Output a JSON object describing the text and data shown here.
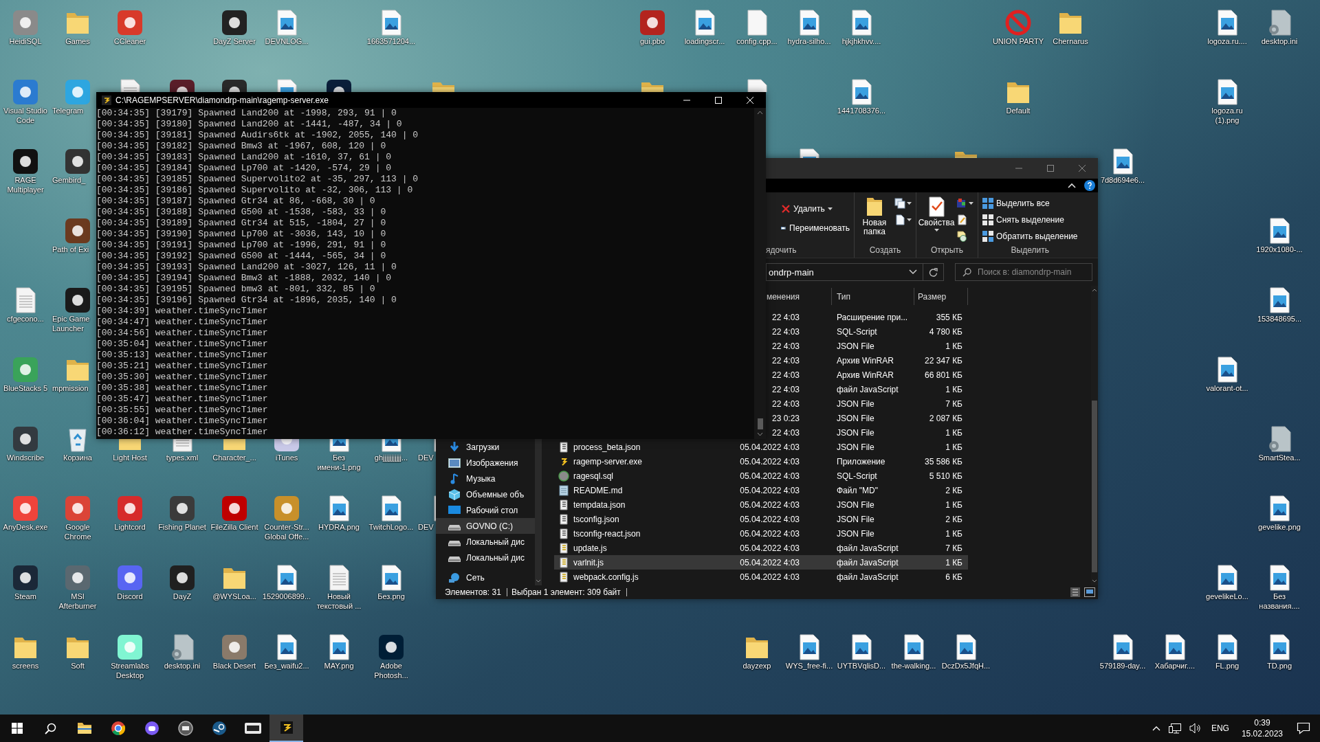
{
  "desktop": {
    "icons": [
      {
        "label": "HeidiSQL",
        "kind": "app",
        "color": "#8a8a8a"
      },
      {
        "label": "Games",
        "kind": "folder"
      },
      {
        "label": "CCleaner",
        "kind": "app",
        "color": "#d83a2a"
      },
      {
        "label": "DayZ Server",
        "kind": "app",
        "color": "#222222"
      },
      {
        "label": "DEVNLOG...",
        "kind": "image"
      },
      {
        "label": "1663571204...",
        "kind": "image"
      },
      {
        "label": "gui.pbo",
        "kind": "app",
        "color": "#b3241e"
      },
      {
        "label": "loadingscr...",
        "kind": "image"
      },
      {
        "label": "config.cpp...",
        "kind": "blank"
      },
      {
        "label": "hydra-silho...",
        "kind": "image"
      },
      {
        "label": "hjkjhkhvv....",
        "kind": "image"
      },
      {
        "label": "UNION PARTY",
        "kind": "ban"
      },
      {
        "label": "Chernarus",
        "kind": "folder"
      },
      {
        "label": "logoza.ru....",
        "kind": "image"
      },
      {
        "label": "desktop.ini",
        "kind": "ini"
      },
      {
        "label": "Visual Studio Code",
        "kind": "app",
        "color": "#2b7bd0"
      },
      {
        "label": "Telegram",
        "kind": "app",
        "color": "#2ea6e0",
        "cut": true
      },
      {
        "kind": "text"
      },
      {
        "kind": "app",
        "color": "#5a1e2a"
      },
      {
        "kind": "app",
        "color": "#2a2a2a"
      },
      {
        "kind": "image"
      },
      {
        "kind": "app",
        "color": "#0b1f3a"
      },
      {
        "kind": "folder"
      },
      {
        "kind": "folder"
      },
      {
        "kind": "blank"
      },
      {
        "label": "1441708376...",
        "kind": "image"
      },
      {
        "label": "Default",
        "kind": "folder"
      },
      {
        "label": "logoza.ru (1).png",
        "kind": "image"
      },
      {
        "label": "RAGE Multiplayer",
        "kind": "app",
        "color": "#111111"
      },
      {
        "label": "Gembird_",
        "kind": "app",
        "color": "#333333",
        "cut": true
      },
      {
        "kind": "image"
      },
      {
        "kind": "folder"
      },
      {
        "label": "7d8d694e6...",
        "kind": "image"
      },
      {
        "label": "Path of Exi",
        "kind": "app",
        "color": "#6b3a1f",
        "cut": true
      },
      {
        "label": "1920x1080-...",
        "kind": "image"
      },
      {
        "label": "cfgecono...",
        "kind": "text"
      },
      {
        "label": "Epic Game Launcher",
        "kind": "app",
        "color": "#1a1a1a",
        "cut": true
      },
      {
        "label": "153848695...",
        "kind": "image"
      },
      {
        "label": "BlueStacks 5",
        "kind": "app",
        "color": "#3aa35a"
      },
      {
        "label": "mpmission",
        "kind": "folder",
        "cut": true
      },
      {
        "label": "valorant-ot...",
        "kind": "image"
      },
      {
        "label": "Windscribe",
        "kind": "app",
        "color": "#333a40"
      },
      {
        "label": "Корзина",
        "kind": "recycle"
      },
      {
        "label": "Light Host",
        "kind": "folder"
      },
      {
        "label": "types.xml",
        "kind": "text"
      },
      {
        "label": "Character_...",
        "kind": "folder"
      },
      {
        "label": "iTunes",
        "kind": "app",
        "color": "#c9c9e8"
      },
      {
        "label": "Без имени-1.png",
        "kind": "image"
      },
      {
        "label": "ghjjjjjjjjjjj...",
        "kind": "image"
      },
      {
        "label": "DEV",
        "kind": "image",
        "cut": true
      },
      {
        "label": "SmartStea...",
        "kind": "ini"
      },
      {
        "label": "AnyDesk.exe",
        "kind": "app",
        "color": "#ef443b"
      },
      {
        "label": "Google Chrome",
        "kind": "app",
        "color": "#db4437"
      },
      {
        "label": "Lightcord",
        "kind": "app",
        "color": "#d62b2b"
      },
      {
        "label": "Fishing Planet",
        "kind": "app",
        "color": "#3b3b3b"
      },
      {
        "label": "FileZilla Client",
        "kind": "app",
        "color": "#bf0000"
      },
      {
        "label": "Counter-Str... Global Offe...",
        "kind": "app",
        "color": "#c8902a"
      },
      {
        "label": "HYDRA.png",
        "kind": "image"
      },
      {
        "label": "TwitchLogo...",
        "kind": "image"
      },
      {
        "label": "DEV",
        "kind": "image",
        "cut": true
      },
      {
        "label": "gevelike.png",
        "kind": "image"
      },
      {
        "label": "Steam",
        "kind": "app",
        "color": "#1b2838"
      },
      {
        "label": "MSI Afterburner",
        "kind": "app",
        "color": "#5a6870"
      },
      {
        "label": "Discord",
        "kind": "app",
        "color": "#5865f2"
      },
      {
        "label": "DayZ",
        "kind": "app",
        "color": "#202020"
      },
      {
        "label": "@WYSLoa...",
        "kind": "folder"
      },
      {
        "label": "1529006899...",
        "kind": "image"
      },
      {
        "label": "Новый текстовый ...",
        "kind": "text"
      },
      {
        "label": "Без.png",
        "kind": "image"
      },
      {
        "label": "gevelikeLo...",
        "kind": "image"
      },
      {
        "label": "Без названия....",
        "kind": "image"
      },
      {
        "label": "screens",
        "kind": "folder"
      },
      {
        "label": "Soft",
        "kind": "folder"
      },
      {
        "label": "Streamlabs Desktop",
        "kind": "app",
        "color": "#80f5d2"
      },
      {
        "label": "desktop.ini",
        "kind": "ini"
      },
      {
        "label": "Black Desert",
        "kind": "app",
        "color": "#8a7a6a"
      },
      {
        "label": "Без_waifu2...",
        "kind": "image"
      },
      {
        "label": "MAY.png",
        "kind": "image"
      },
      {
        "label": "Adobe Photosh...",
        "kind": "app",
        "color": "#001e36"
      },
      {
        "label": "dayzexp",
        "kind": "folder"
      },
      {
        "label": "WYS_free-fi...",
        "kind": "image"
      },
      {
        "label": "UYTBVqlisD...",
        "kind": "image"
      },
      {
        "label": "the-walking...",
        "kind": "image"
      },
      {
        "label": "DczDx5JfqH...",
        "kind": "image"
      },
      {
        "label": "579189-day...",
        "kind": "image"
      },
      {
        "label": "Хабарчиг....",
        "kind": "image"
      },
      {
        "label": "FL.png",
        "kind": "image"
      },
      {
        "label": "TD.png",
        "kind": "image"
      }
    ]
  },
  "console": {
    "title": "C:\\RAGEMPSERVER\\diamondrp-main\\ragemp-server.exe",
    "lines": [
      "[00:34:35] [39179] Spawned Land200 at -1998, 293, 91 | 0",
      "[00:34:35] [39180] Spawned Land200 at -1441, -487, 34 | 0",
      "[00:34:35] [39181] Spawned Audirs6tk at -1902, 2055, 140 | 0",
      "[00:34:35] [39182] Spawned Bmw3 at -1967, 608, 120 | 0",
      "[00:34:35] [39183] Spawned Land200 at -1610, 37, 61 | 0",
      "[00:34:35] [39184] Spawned Lp700 at -1420, -574, 29 | 0",
      "[00:34:35] [39185] Spawned Supervolito2 at -35, 297, 113 | 0",
      "[00:34:35] [39186] Spawned Supervolito at -32, 306, 113 | 0",
      "[00:34:35] [39187] Spawned Gtr34 at 86, -668, 30 | 0",
      "[00:34:35] [39188] Spawned G500 at -1538, -583, 33 | 0",
      "[00:34:35] [39189] Spawned Gtr34 at 515, -1804, 27 | 0",
      "[00:34:35] [39190] Spawned Lp700 at -3036, 143, 10 | 0",
      "[00:34:35] [39191] Spawned Lp700 at -1996, 291, 91 | 0",
      "[00:34:35] [39192] Spawned G500 at -1444, -565, 34 | 0",
      "[00:34:35] [39193] Spawned Land200 at -3027, 126, 11 | 0",
      "[00:34:35] [39194] Spawned Bmw3 at -1888, 2032, 140 | 0",
      "[00:34:35] [39195] Spawned bmw3 at -801, 332, 85 | 0",
      "[00:34:35] [39196] Spawned Gtr34 at -1896, 2035, 140 | 0",
      "[00:34:39] weather.timeSyncTimer",
      "[00:34:47] weather.timeSyncTimer",
      "[00:34:56] weather.timeSyncTimer",
      "[00:35:04] weather.timeSyncTimer",
      "[00:35:13] weather.timeSyncTimer",
      "[00:35:21] weather.timeSyncTimer",
      "[00:35:30] weather.timeSyncTimer",
      "[00:35:38] weather.timeSyncTimer",
      "[00:35:47] weather.timeSyncTimer",
      "[00:35:55] weather.timeSyncTimer",
      "[00:36:04] weather.timeSyncTimer",
      "[00:36:12] weather.timeSyncTimer"
    ]
  },
  "explorer": {
    "ribbon": {
      "delete": "Удалить",
      "rename": "Переименовать",
      "new_folder": "Новая папка",
      "properties": "Свойства",
      "select_all": "Выделить все",
      "select_none": "Снять выделение",
      "invert_selection": "Обратить выделение",
      "groups": [
        "ядочить",
        "Создать",
        "Открыть",
        "Выделить"
      ]
    },
    "address": "ondrp-main",
    "search": {
      "placeholder": "Поиск в: diamondrp-main"
    },
    "columns": [
      "менения",
      "Тип",
      "Размер"
    ],
    "nav": [
      {
        "label": "Загрузки",
        "kind": "downloads",
        "selected": false
      },
      {
        "label": "Изображения",
        "kind": "pictures",
        "selected": false
      },
      {
        "label": "Музыка",
        "kind": "music",
        "selected": false
      },
      {
        "label": "Объемные объ",
        "kind": "objects",
        "selected": false
      },
      {
        "label": "Рабочий стол",
        "kind": "desktop",
        "selected": false
      },
      {
        "label": "GOVNO (C:)",
        "kind": "drive",
        "selected": true
      },
      {
        "label": "Локальный дис",
        "kind": "drive",
        "selected": false
      },
      {
        "label": "Локальный дис",
        "kind": "drive",
        "selected": false
      },
      {
        "label": "Сеть",
        "kind": "network",
        "selected": false
      }
    ],
    "files": [
      {
        "date": "22 4:03",
        "type": "Расширение при...",
        "size": "355 КБ",
        "selected": false
      },
      {
        "date": "22 4:03",
        "type": "SQL-Script",
        "size": "4 780 КБ",
        "selected": false
      },
      {
        "date": "22 4:03",
        "type": "JSON File",
        "size": "1 КБ",
        "selected": false
      },
      {
        "date": "22 4:03",
        "type": "Архив WinRAR",
        "size": "22 347 КБ",
        "selected": false
      },
      {
        "date": "22 4:03",
        "type": "Архив WinRAR",
        "size": "66 801 КБ",
        "selected": false
      },
      {
        "date": "22 4:03",
        "type": "файл JavaScript",
        "size": "1 КБ",
        "selected": false
      },
      {
        "date": "22 4:03",
        "type": "JSON File",
        "size": "7 КБ",
        "selected": false
      },
      {
        "date": "23 0:23",
        "type": "JSON File",
        "size": "2 087 КБ",
        "selected": false
      },
      {
        "date": "22 4:03",
        "type": "JSON File",
        "size": "1 КБ",
        "selected": false
      },
      {
        "name": "process_beta.json",
        "kind": "json",
        "date": "05.04.2022 4:03",
        "type": "JSON File",
        "size": "1 КБ",
        "selected": false
      },
      {
        "name": "ragemp-server.exe",
        "kind": "exe",
        "date": "05.04.2022 4:03",
        "type": "Приложение",
        "size": "35 586 КБ",
        "selected": false
      },
      {
        "name": "ragesql.sql",
        "kind": "sql",
        "date": "05.04.2022 4:03",
        "type": "SQL-Script",
        "size": "5 510 КБ",
        "selected": false
      },
      {
        "name": "README.md",
        "kind": "md",
        "date": "05.04.2022 4:03",
        "type": "Файл \"MD\"",
        "size": "2 КБ",
        "selected": false
      },
      {
        "name": "tempdata.json",
        "kind": "json",
        "date": "05.04.2022 4:03",
        "type": "JSON File",
        "size": "1 КБ",
        "selected": false
      },
      {
        "name": "tsconfig.json",
        "kind": "json",
        "date": "05.04.2022 4:03",
        "type": "JSON File",
        "size": "2 КБ",
        "selected": false
      },
      {
        "name": "tsconfig-react.json",
        "kind": "json",
        "date": "05.04.2022 4:03",
        "type": "JSON File",
        "size": "1 КБ",
        "selected": false
      },
      {
        "name": "update.js",
        "kind": "js",
        "date": "05.04.2022 4:03",
        "type": "файл JavaScript",
        "size": "7 КБ",
        "selected": false
      },
      {
        "name": "varlnit.js",
        "kind": "js",
        "date": "05.04.2022 4:03",
        "type": "файл JavaScript",
        "size": "1 КБ",
        "selected": true
      },
      {
        "name": "webpack.config.js",
        "kind": "js",
        "date": "05.04.2022 4:03",
        "type": "файл JavaScript",
        "size": "6 КБ",
        "selected": false
      }
    ],
    "status": [
      "Элементов: 31",
      "Выбран 1 элемент: 309 байт"
    ]
  },
  "taskbar": {
    "apps": [
      {
        "selected": false
      },
      {
        "selected": false
      },
      {
        "selected": false
      },
      {
        "selected": false
      },
      {
        "selected": false
      },
      {
        "selected": false
      },
      {
        "selected": true
      }
    ],
    "language": "ENG",
    "time": "0:39",
    "date": "15.02.2023"
  }
}
